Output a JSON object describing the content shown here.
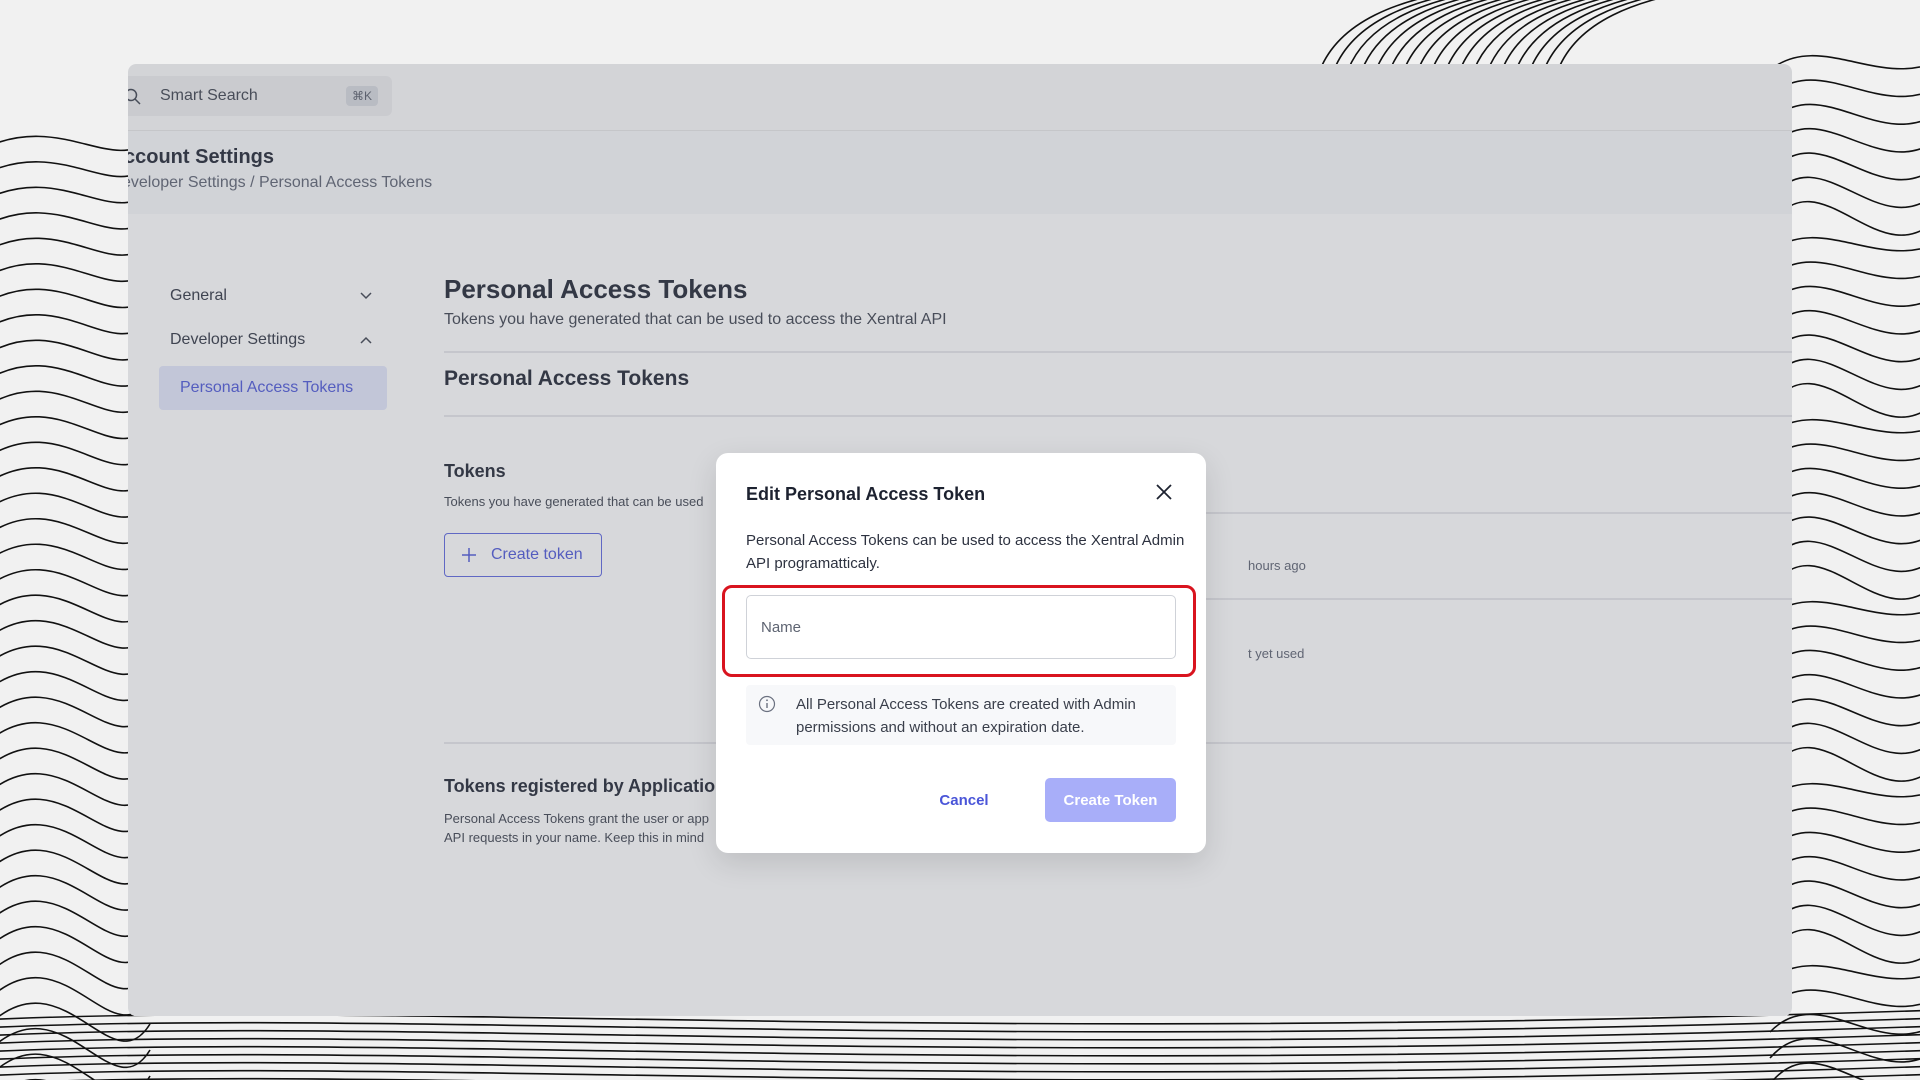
{
  "search": {
    "label": "Smart Search",
    "shortcut": "⌘K"
  },
  "page": {
    "title": "ccount Settings",
    "breadcrumb": "eveloper Settings / Personal Access Tokens"
  },
  "sidebar": {
    "items": [
      {
        "label": "General",
        "chevron": "chevron-down-icon"
      },
      {
        "label": "Developer Settings",
        "chevron": "chevron-up-icon"
      }
    ],
    "active_sub": "Personal Access Tokens"
  },
  "main": {
    "title": "Personal Access Tokens",
    "subtitle": "Tokens you have generated that can be used to access the Xentral API",
    "section_title": "Personal Access Tokens",
    "tokens_heading": "Tokens",
    "tokens_desc": "Tokens you have generated that can be used",
    "create_token_label": "Create token",
    "token_rows": [
      {
        "meta": "hours ago"
      },
      {
        "meta": "t yet used"
      }
    ],
    "apps_heading": "Tokens registered by Applicatio",
    "apps_desc_line1": "Personal Access Tokens grant the user or app",
    "apps_desc_line2": "API requests in your name. Keep this in mind"
  },
  "modal": {
    "title": "Edit Personal Access Token",
    "description": "Personal Access Tokens can be used to access the Xentral Admin API programatticaly.",
    "name_placeholder": "Name",
    "name_value": "",
    "info": "All Personal Access Tokens are created with Admin permissions and without an expiration date.",
    "cancel_label": "Cancel",
    "create_label": "Create Token",
    "highlight_color": "#d9141f",
    "accent_color": "#4a55d8"
  }
}
